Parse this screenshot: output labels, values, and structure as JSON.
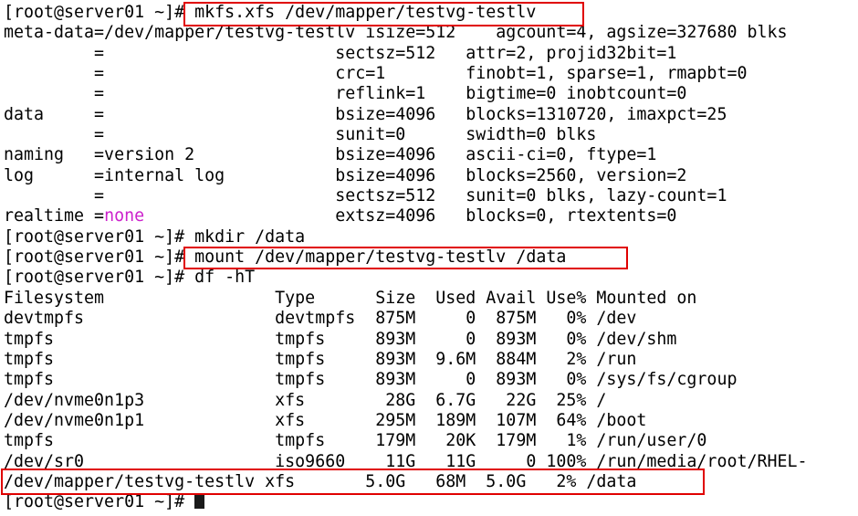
{
  "terminal": {
    "lines": [
      {
        "prompt": "[root@server01 ~]",
        "command": "# mkfs.xfs /dev/mapper/testvg-testlv"
      },
      {
        "text": "meta-data=/dev/mapper/testvg-testlv isize=512    agcount=4, agsize=327680 blks"
      },
      {
        "text": "         =                       sectsz=512   attr=2, projid32bit=1"
      },
      {
        "text": "         =                       crc=1        finobt=1, sparse=1, rmapbt=0"
      },
      {
        "text": "         =                       reflink=1    bigtime=0 inobtcount=0"
      },
      {
        "text": "data     =                       bsize=4096   blocks=1310720, imaxpct=25"
      },
      {
        "text": "         =                       sunit=0      swidth=0 blks"
      },
      {
        "text": "naming   =version 2              bsize=4096   ascii-ci=0, ftype=1"
      },
      {
        "text": "log      =internal log           bsize=4096   blocks=2560, version=2"
      },
      {
        "text": "         =                       sectsz=512   sunit=0 blks, lazy-count=1"
      },
      {
        "pre": "realtime =",
        "magenta": "none",
        "post": "                   extsz=4096   blocks=0, rtextents=0"
      },
      {
        "prompt": "[root@server01 ~]",
        "command": "# mkdir /data"
      },
      {
        "prompt": "[root@server01 ~]",
        "command": "# mount /dev/mapper/testvg-testlv /data"
      },
      {
        "prompt": "[root@server01 ~]",
        "command": "# df -hT"
      },
      {
        "text": "Filesystem                 Type      Size  Used Avail Use% Mounted on"
      },
      {
        "text": "devtmpfs                   devtmpfs  875M     0  875M   0% /dev"
      },
      {
        "text": "tmpfs                      tmpfs     893M     0  893M   0% /dev/shm"
      },
      {
        "text": "tmpfs                      tmpfs     893M  9.6M  884M   2% /run"
      },
      {
        "text": "tmpfs                      tmpfs     893M     0  893M   0% /sys/fs/cgroup"
      },
      {
        "text": "/dev/nvme0n1p3             xfs        28G  6.7G   22G  25% /"
      },
      {
        "text": "/dev/nvme0n1p1             xfs       295M  189M  107M  64% /boot"
      },
      {
        "text": "tmpfs                      tmpfs     179M   20K  179M   1% /run/user/0"
      },
      {
        "text": "/dev/sr0                   iso9660    11G   11G     0 100% /run/media/root/RHEL-"
      },
      {
        "text": "/dev/mapper/testvg-testlv xfs       5.0G   68M  5.0G   2% /data"
      },
      {
        "prompt": "[root@server01 ~]",
        "command": "# "
      }
    ]
  },
  "colors": {
    "background": "#ffffff",
    "text": "#000000",
    "highlight_box": "#e00000",
    "keyword_none": "#cc22cc"
  }
}
